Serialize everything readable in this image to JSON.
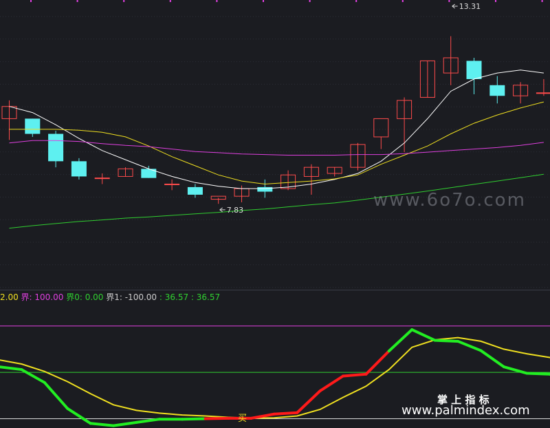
{
  "chart_data": [
    {
      "type": "candlestick",
      "ylim": [
        5.0,
        14.5
      ],
      "annotations": [
        {
          "label": "13.31",
          "candle": 19,
          "value": 13.31
        },
        {
          "label": "7.83",
          "candle": 9,
          "value": 7.83
        }
      ],
      "candles": [
        {
          "open": 10.6,
          "high": 11.2,
          "low": 9.9,
          "close": 11.0
        },
        {
          "open": 10.6,
          "high": 10.6,
          "low": 10.0,
          "close": 10.1
        },
        {
          "open": 10.1,
          "high": 10.2,
          "low": 9.0,
          "close": 9.2
        },
        {
          "open": 9.2,
          "high": 9.3,
          "low": 8.6,
          "close": 8.7
        },
        {
          "open": 8.65,
          "high": 8.8,
          "low": 8.45,
          "close": 8.65
        },
        {
          "open": 8.7,
          "high": 9.0,
          "low": 8.7,
          "close": 8.95
        },
        {
          "open": 8.95,
          "high": 9.05,
          "low": 8.65,
          "close": 8.65
        },
        {
          "open": 8.45,
          "high": 8.6,
          "low": 8.25,
          "close": 8.45
        },
        {
          "open": 8.35,
          "high": 8.45,
          "low": 8.0,
          "close": 8.1
        },
        {
          "open": 7.95,
          "high": 8.0,
          "low": 7.8,
          "close": 8.05
        },
        {
          "open": 8.05,
          "high": 8.4,
          "low": 7.85,
          "close": 8.3
        },
        {
          "open": 8.35,
          "high": 8.6,
          "low": 8.0,
          "close": 8.2
        },
        {
          "open": 8.3,
          "high": 8.9,
          "low": 8.25,
          "close": 8.75
        },
        {
          "open": 8.7,
          "high": 9.1,
          "low": 8.1,
          "close": 9.0
        },
        {
          "open": 8.8,
          "high": 9.0,
          "low": 8.7,
          "close": 9.0
        },
        {
          "open": 9.0,
          "high": 9.8,
          "low": 8.9,
          "close": 9.75
        },
        {
          "open": 10.0,
          "high": 10.0,
          "low": 9.6,
          "close": 10.6
        },
        {
          "open": 10.6,
          "high": 11.3,
          "low": 9.5,
          "close": 11.2
        },
        {
          "open": 11.3,
          "high": 12.5,
          "low": 11.3,
          "close": 12.5
        },
        {
          "open": 12.1,
          "high": 13.31,
          "low": 11.7,
          "close": 12.6
        },
        {
          "open": 12.5,
          "high": 12.6,
          "low": 11.4,
          "close": 11.9
        },
        {
          "open": 11.7,
          "high": 12.0,
          "low": 11.1,
          "close": 11.35
        },
        {
          "open": 11.35,
          "high": 11.8,
          "low": 11.1,
          "close": 11.7
        },
        {
          "open": 11.45,
          "high": 11.9,
          "low": 11.35,
          "close": 11.45
        }
      ],
      "ma": [
        {
          "color": "#ffffff",
          "values": [
            11.0,
            10.8,
            10.4,
            9.95,
            9.55,
            9.25,
            8.95,
            8.7,
            8.5,
            8.38,
            8.3,
            8.3,
            8.35,
            8.45,
            8.6,
            8.8,
            9.2,
            9.8,
            10.6,
            11.5,
            11.9,
            12.1,
            12.2,
            12.1
          ]
        },
        {
          "color": "#f0e020",
          "values": [
            10.25,
            10.25,
            10.25,
            10.22,
            10.15,
            10.0,
            9.7,
            9.35,
            9.05,
            8.75,
            8.55,
            8.45,
            8.5,
            8.55,
            8.62,
            8.75,
            9.1,
            9.4,
            9.7,
            10.1,
            10.45,
            10.72,
            10.95,
            11.15
          ]
        },
        {
          "color": "#e040e0",
          "values": [
            9.8,
            9.88,
            9.88,
            9.85,
            9.78,
            9.72,
            9.68,
            9.6,
            9.52,
            9.48,
            9.44,
            9.42,
            9.4,
            9.4,
            9.4,
            9.42,
            9.42,
            9.45,
            9.5,
            9.55,
            9.6,
            9.65,
            9.72,
            9.82
          ]
        },
        {
          "color": "#30d030",
          "values": [
            7.0,
            7.08,
            7.15,
            7.22,
            7.27,
            7.33,
            7.37,
            7.42,
            7.47,
            7.52,
            7.58,
            7.63,
            7.7,
            7.77,
            7.83,
            7.92,
            8.02,
            8.12,
            8.22,
            8.33,
            8.44,
            8.55,
            8.66,
            8.77
          ]
        }
      ]
    },
    {
      "type": "line",
      "ylim": [
        -120,
        150
      ],
      "legend": [
        {
          "text": "2.00",
          "color": "#f0e020"
        },
        {
          "text": " 界: 100.00",
          "color": "#e040e0"
        },
        {
          "text": " 界0: 0.00",
          "color": "#30d030"
        },
        {
          "text": " 界1: -100.00",
          "color": "#cccccc"
        },
        {
          "text": " : 36.57",
          "color": "#30d030"
        },
        {
          "text": " : 36.57",
          "color": "#30d030"
        }
      ],
      "hlines": [
        {
          "value": 100,
          "color": "#e040e0"
        },
        {
          "value": 0,
          "color": "#30d030"
        },
        {
          "value": -100,
          "color": "#dddddd"
        }
      ],
      "series": [
        {
          "role": "fast",
          "color_up": "#ff1a1a",
          "color_down": "#22ee22",
          "values": [
            12,
            6,
            -22,
            -78,
            -110,
            -115,
            -108,
            -101,
            -101,
            -100,
            -99,
            -99,
            -90,
            -87,
            -40,
            -8,
            -4,
            46,
            92,
            69,
            67,
            47,
            12,
            -2,
            -4,
            -14
          ]
        },
        {
          "role": "slow",
          "color": "#f0e020",
          "values": [
            27,
            18,
            2,
            -20,
            -46,
            -70,
            -82,
            -88,
            -92,
            -94,
            -97,
            -99,
            -98,
            -94,
            -80,
            -54,
            -30,
            6,
            54,
            70,
            75,
            67,
            50,
            40,
            32,
            22
          ]
        }
      ],
      "marker": {
        "text": "买",
        "color": "#f0e020",
        "index": 10
      }
    }
  ],
  "watermarks": {
    "mid": "www.6o7o.com",
    "title": "掌 上 指 标",
    "site": "www.palmindex.com"
  }
}
